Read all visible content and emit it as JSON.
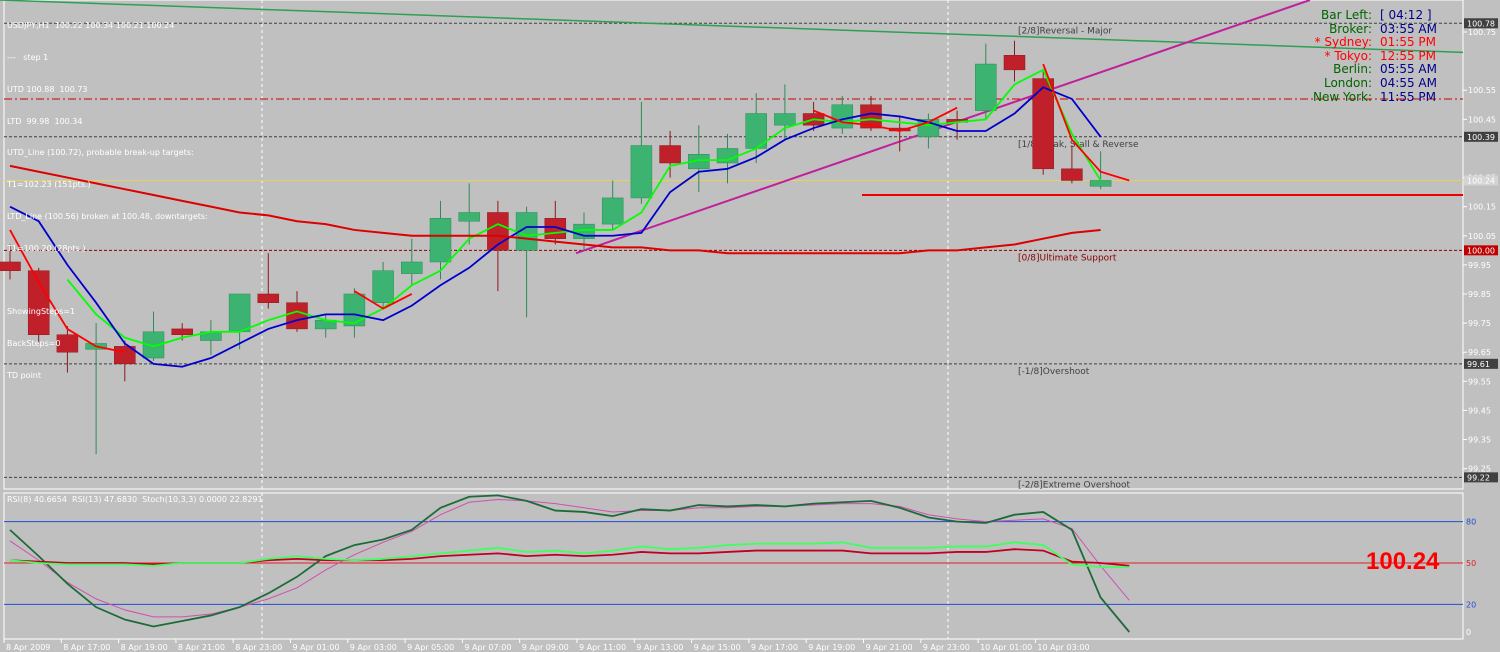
{
  "chart_data": {
    "type": "candlestick",
    "symbol_header": "USDJPY,H1  100.22 100.34 100.21 100.24",
    "info_lines": [
      "UTD 100.88  100.73",
      "LTD  99.98  100.34",
      "UTD_Line (100.72), probable break-up targets:",
      "T1=102.23 (151pts.)",
      "LTD_Line (100.56) broken at 100.48, downtargets:",
      "T1=100.20 (28pts.)",
      "",
      "ShowingSteps=1",
      "BackSteps=0",
      "TD point"
    ],
    "step_label": "---   step 1",
    "clock": [
      {
        "label": "Bar Left:",
        "value": "[ 04:12 ]",
        "color": "#006400",
        "vcolor": "#00008b"
      },
      {
        "label": "Broker:",
        "value": "03:55 AM",
        "color": "#006400",
        "vcolor": "#00008b"
      },
      {
        "label": "* Sydney:",
        "value": "01:55 PM",
        "color": "#ff0000",
        "vcolor": "#ff0000"
      },
      {
        "label": "* Tokyo:",
        "value": "12:55 PM",
        "color": "#ff0000",
        "vcolor": "#ff0000"
      },
      {
        "label": "Berlin:",
        "value": "05:55 AM",
        "color": "#006400",
        "vcolor": "#00008b"
      },
      {
        "label": "London:",
        "value": "04:55 AM",
        "color": "#006400",
        "vcolor": "#00008b"
      },
      {
        "label": "New York:",
        "value": "11:55 PM",
        "color": "#006400",
        "vcolor": "#00008b"
      }
    ],
    "price_axis": {
      "min": 99.18,
      "max": 100.86,
      "ticks": [
        "100.75",
        "100.55",
        "100.45",
        "100.25",
        "100.15",
        "100.05",
        "99.95",
        "99.85",
        "99.75",
        "99.65",
        "99.55",
        "99.45",
        "99.35",
        "99.25"
      ]
    },
    "price_tags": [
      {
        "value": 100.78,
        "label": "100.78",
        "bg": "#404040"
      },
      {
        "value": 100.39,
        "label": "100.39",
        "bg": "#404040"
      },
      {
        "value": 100.24,
        "label": "100.24",
        "bg": "#d4d4d4"
      },
      {
        "value": 100.0,
        "label": "100.00",
        "bg": "#c00000"
      },
      {
        "value": 99.61,
        "label": "99.61",
        "bg": "#404040"
      },
      {
        "value": 99.22,
        "label": "99.22",
        "bg": "#404040"
      }
    ],
    "murrey_labels": [
      {
        "value": 100.78,
        "text": "[2/8]Reversal - Major",
        "color": "#404040"
      },
      {
        "value": 100.39,
        "text": "[1/8]Weak, Stall & Reverse",
        "color": "#404040"
      },
      {
        "value": 100.0,
        "text": "[0/8]Ultimate Support",
        "color": "#8b0000"
      },
      {
        "value": 99.61,
        "text": "[-1/8]Overshoot",
        "color": "#404040"
      },
      {
        "value": 99.22,
        "text": "[-2/8]Extreme Overshoot",
        "color": "#404040"
      }
    ],
    "time_labels": [
      "8 Apr 2009",
      "8 Apr 17:00",
      "8 Apr 19:00",
      "8 Apr 21:00",
      "8 Apr 23:00",
      "9 Apr 01:00",
      "9 Apr 03:00",
      "9 Apr 05:00",
      "9 Apr 07:00",
      "9 Apr 09:00",
      "9 Apr 11:00",
      "9 Apr 13:00",
      "9 Apr 15:00",
      "9 Apr 17:00",
      "9 Apr 19:00",
      "9 Apr 21:00",
      "9 Apr 23:00",
      "10 Apr 01:00",
      "10 Apr 03:00"
    ],
    "candles": [
      {
        "o": 99.96,
        "h": 100.02,
        "l": 99.9,
        "c": 99.93
      },
      {
        "o": 99.93,
        "h": 99.94,
        "l": 99.68,
        "c": 99.71
      },
      {
        "o": 99.71,
        "h": 99.74,
        "l": 99.58,
        "c": 99.65
      },
      {
        "o": 99.66,
        "h": 99.75,
        "l": 99.3,
        "c": 99.68
      },
      {
        "o": 99.67,
        "h": 99.69,
        "l": 99.55,
        "c": 99.61
      },
      {
        "o": 99.63,
        "h": 99.79,
        "l": 99.62,
        "c": 99.72
      },
      {
        "o": 99.73,
        "h": 99.75,
        "l": 99.69,
        "c": 99.71
      },
      {
        "o": 99.69,
        "h": 99.76,
        "l": 99.64,
        "c": 99.72
      },
      {
        "o": 99.72,
        "h": 99.85,
        "l": 99.66,
        "c": 99.85
      },
      {
        "o": 99.85,
        "h": 99.99,
        "l": 99.8,
        "c": 99.82
      },
      {
        "o": 99.82,
        "h": 99.86,
        "l": 99.72,
        "c": 99.73
      },
      {
        "o": 99.73,
        "h": 99.78,
        "l": 99.7,
        "c": 99.76
      },
      {
        "o": 99.74,
        "h": 99.87,
        "l": 99.7,
        "c": 99.85
      },
      {
        "o": 99.82,
        "h": 99.96,
        "l": 99.8,
        "c": 99.93
      },
      {
        "o": 99.92,
        "h": 100.04,
        "l": 99.88,
        "c": 99.96
      },
      {
        "o": 99.96,
        "h": 100.17,
        "l": 99.9,
        "c": 100.11
      },
      {
        "o": 100.1,
        "h": 100.23,
        "l": 100.02,
        "c": 100.13
      },
      {
        "o": 100.13,
        "h": 100.17,
        "l": 99.86,
        "c": 100.0
      },
      {
        "o": 100.0,
        "h": 100.15,
        "l": 99.77,
        "c": 100.13
      },
      {
        "o": 100.11,
        "h": 100.17,
        "l": 100.02,
        "c": 100.04
      },
      {
        "o": 100.04,
        "h": 100.13,
        "l": 100.0,
        "c": 100.09
      },
      {
        "o": 100.09,
        "h": 100.24,
        "l": 100.07,
        "c": 100.18
      },
      {
        "o": 100.18,
        "h": 100.51,
        "l": 100.16,
        "c": 100.36
      },
      {
        "o": 100.36,
        "h": 100.41,
        "l": 100.25,
        "c": 100.3
      },
      {
        "o": 100.28,
        "h": 100.43,
        "l": 100.2,
        "c": 100.33
      },
      {
        "o": 100.3,
        "h": 100.4,
        "l": 100.23,
        "c": 100.35
      },
      {
        "o": 100.35,
        "h": 100.54,
        "l": 100.3,
        "c": 100.47
      },
      {
        "o": 100.43,
        "h": 100.57,
        "l": 100.38,
        "c": 100.47
      },
      {
        "o": 100.47,
        "h": 100.51,
        "l": 100.41,
        "c": 100.43
      },
      {
        "o": 100.42,
        "h": 100.53,
        "l": 100.4,
        "c": 100.5
      },
      {
        "o": 100.5,
        "h": 100.53,
        "l": 100.41,
        "c": 100.42
      },
      {
        "o": 100.42,
        "h": 100.46,
        "l": 100.34,
        "c": 100.41
      },
      {
        "o": 100.39,
        "h": 100.47,
        "l": 100.35,
        "c": 100.45
      },
      {
        "o": 100.45,
        "h": 100.48,
        "l": 100.38,
        "c": 100.44
      },
      {
        "o": 100.48,
        "h": 100.71,
        "l": 100.45,
        "c": 100.64
      },
      {
        "o": 100.67,
        "h": 100.72,
        "l": 100.58,
        "c": 100.62
      },
      {
        "o": 100.59,
        "h": 100.62,
        "l": 100.26,
        "c": 100.28
      },
      {
        "o": 100.28,
        "h": 100.36,
        "l": 100.23,
        "c": 100.24
      },
      {
        "o": 100.22,
        "h": 100.34,
        "l": 100.21,
        "c": 100.24
      }
    ],
    "moving_averages": [
      {
        "name": "fast",
        "color": "#00ff00",
        "values": [
          null,
          null,
          99.9,
          99.78,
          99.7,
          99.67,
          99.7,
          99.72,
          99.72,
          99.76,
          99.79,
          99.76,
          99.75,
          99.8,
          99.88,
          99.93,
          100.04,
          100.09,
          100.05,
          100.06,
          100.07,
          100.07,
          100.13,
          100.29,
          100.31,
          100.31,
          100.35,
          100.42,
          100.45,
          100.44,
          100.45,
          100.44,
          100.43,
          100.44,
          100.45,
          100.57,
          100.62,
          100.4,
          100.24
        ]
      },
      {
        "name": "slow",
        "color": "#0000cd",
        "values": [
          100.15,
          100.1,
          99.95,
          99.82,
          99.68,
          99.61,
          99.6,
          99.63,
          99.68,
          99.73,
          99.76,
          99.78,
          99.78,
          99.76,
          99.81,
          99.88,
          99.94,
          100.02,
          100.08,
          100.08,
          100.05,
          100.05,
          100.06,
          100.2,
          100.27,
          100.28,
          100.32,
          100.38,
          100.42,
          100.45,
          100.47,
          100.46,
          100.44,
          100.41,
          100.41,
          100.47,
          100.56,
          100.52,
          100.39
        ]
      },
      {
        "name": "trend",
        "color": "#ff0000",
        "values": [
          100.07,
          99.89,
          99.73,
          99.67,
          99.65,
          null,
          null,
          null,
          null,
          null,
          null,
          null,
          99.86,
          99.8,
          99.85,
          null,
          null,
          null,
          null,
          null,
          null,
          null,
          null,
          null,
          null,
          null,
          null,
          null,
          100.48,
          100.44,
          100.43,
          100.41,
          100.44,
          100.49,
          null,
          null,
          100.64,
          100.38,
          100.27,
          100.24
        ]
      },
      {
        "name": "ma-long",
        "color": "#dd0000",
        "values": [
          100.29,
          100.27,
          100.25,
          100.23,
          100.21,
          100.19,
          100.17,
          100.15,
          100.13,
          100.12,
          100.1,
          100.09,
          100.07,
          100.06,
          100.05,
          100.05,
          100.05,
          100.05,
          100.04,
          100.03,
          100.02,
          100.01,
          100.01,
          100.0,
          100.0,
          99.99,
          99.99,
          99.99,
          99.99,
          99.99,
          99.99,
          99.99,
          100.0,
          100.0,
          100.01,
          100.02,
          100.04,
          100.06,
          100.07
        ]
      }
    ],
    "indicator": {
      "label": "RSI(8) 40.6654  RSI(13) 47.6830  Stoch(10,3,3) 0.0000 22.8291",
      "levels": [
        "80",
        "50",
        "20",
        "0"
      ],
      "big_price": "100.24",
      "rsi8": [
        52,
        50,
        49,
        49,
        49,
        48,
        50,
        50,
        50,
        53,
        55,
        53,
        52,
        53,
        55,
        57,
        59,
        61,
        58,
        59,
        57,
        59,
        62,
        60,
        61,
        63,
        64,
        64,
        64,
        65,
        61,
        61,
        61,
        62,
        62,
        65,
        63,
        49,
        47,
        47
      ],
      "rsi13": [
        52,
        51,
        50,
        50,
        50,
        49,
        50,
        50,
        50,
        52,
        53,
        52,
        52,
        52,
        53,
        55,
        56,
        57,
        55,
        56,
        55,
        56,
        58,
        57,
        57,
        58,
        59,
        59,
        59,
        59,
        57,
        57,
        57,
        58,
        58,
        60,
        59,
        51,
        50,
        48
      ],
      "stoch_main": [
        74,
        55,
        35,
        18,
        9,
        4,
        8,
        12,
        18,
        28,
        40,
        55,
        63,
        67,
        74,
        90,
        98,
        99,
        95,
        88,
        87,
        84,
        89,
        88,
        92,
        91,
        92,
        91,
        93,
        94,
        95,
        90,
        83,
        80,
        79,
        85,
        87,
        74,
        25,
        0
      ],
      "stoch_signal": [
        66,
        52,
        36,
        24,
        16,
        11,
        11,
        13,
        18,
        24,
        32,
        45,
        56,
        65,
        73,
        85,
        94,
        96,
        95,
        93,
        90,
        87,
        88,
        88,
        90,
        90,
        91,
        91,
        92,
        93,
        93,
        91,
        85,
        82,
        80,
        81,
        82,
        75,
        48,
        23
      ]
    }
  }
}
